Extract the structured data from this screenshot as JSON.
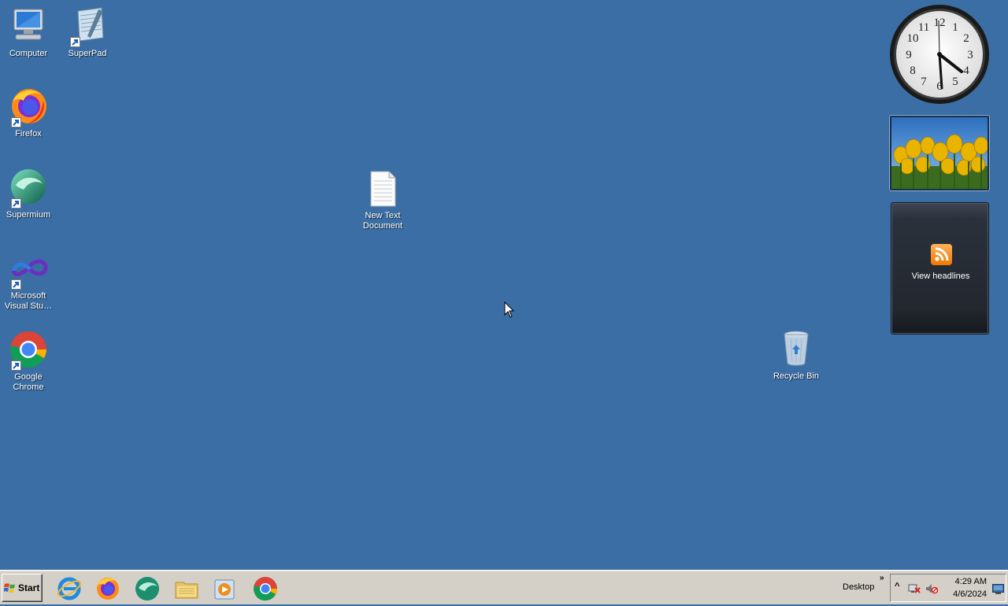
{
  "desktop_icons": [
    {
      "label": "Computer",
      "icon": "computer-icon"
    },
    {
      "label": "SuperPad",
      "icon": "notepad-icon"
    },
    {
      "label": "Firefox",
      "icon": "firefox-icon"
    },
    {
      "label": "Supermium",
      "icon": "supermium-icon"
    },
    {
      "label": "Microsoft Visual Stu…",
      "icon": "visual-studio-icon"
    },
    {
      "label": "Google Chrome",
      "icon": "chrome-icon"
    },
    {
      "label": "New Text Document",
      "icon": "text-document-icon"
    },
    {
      "label": "Recycle Bin",
      "icon": "recycle-bin-icon"
    }
  ],
  "gadgets": {
    "clock": {
      "numerals": [
        "12",
        "1",
        "2",
        "3",
        "4",
        "5",
        "6",
        "7",
        "8",
        "9",
        "10",
        "11"
      ]
    },
    "feed": {
      "label": "View headlines",
      "icon": "rss-icon"
    }
  },
  "taskbar": {
    "start_label": "Start",
    "pinned": [
      {
        "name": "Internet Explorer",
        "icon": "internet-explorer-icon"
      },
      {
        "name": "Firefox",
        "icon": "firefox-icon"
      },
      {
        "name": "Supermium",
        "icon": "supermium-icon"
      },
      {
        "name": "File Explorer",
        "icon": "folder-icon"
      },
      {
        "name": "Media Player",
        "icon": "media-player-icon"
      },
      {
        "name": "Google Chrome",
        "icon": "chrome-icon"
      }
    ],
    "toolbar_label": "Desktop",
    "chevron": "»"
  },
  "tray": {
    "time": "4:29 AM",
    "date": "4/6/2024",
    "icons": [
      "network-error-icon",
      "volume-muted-icon",
      "show-desktop-icon"
    ]
  },
  "colors": {
    "desktop_background": "#3a6ea5",
    "taskbar": "#d4d0c8"
  }
}
